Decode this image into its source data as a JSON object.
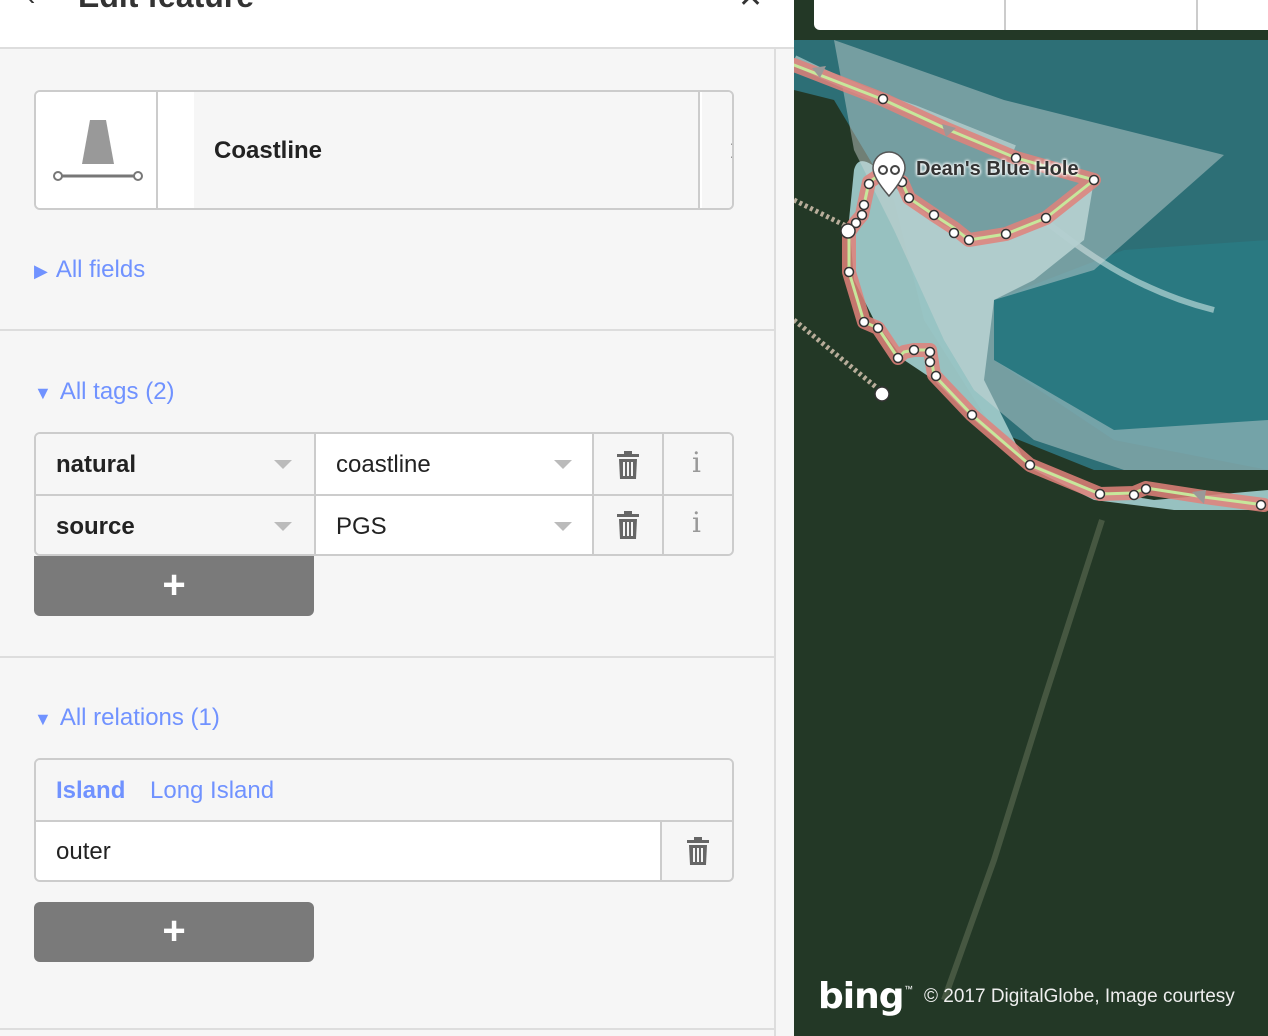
{
  "header": {
    "title": "Edit feature",
    "back_icon": "chevron-left-icon",
    "close_icon": "close-icon"
  },
  "preset": {
    "name": "Coastline",
    "icon": "coastline-icon",
    "info_label": "i"
  },
  "fields_section": {
    "label": "All fields"
  },
  "tags_section": {
    "label": "All tags (2)",
    "rows": [
      {
        "key": "natural",
        "value": "coastline",
        "info_label": "i"
      },
      {
        "key": "source",
        "value": "PGS",
        "info_label": "i"
      }
    ],
    "add_label": "+"
  },
  "relations_section": {
    "label": "All relations (1)",
    "relation": {
      "type": "Island",
      "name": "Long Island",
      "role": "outer"
    },
    "add_label": "+"
  },
  "map": {
    "label": "Dean's Blue Hole",
    "bing_logo": "bing",
    "bing_tm": "™",
    "attribution": "© 2017 DigitalGlobe, Image courtesy",
    "colors": {
      "land": "#233826",
      "water_shallow": "#8fbfc0",
      "water_deep": "#2f7a82",
      "coastline_casing": "#e0817a",
      "coastline_line": "#c7e79b",
      "accent": "#7092ff"
    }
  }
}
